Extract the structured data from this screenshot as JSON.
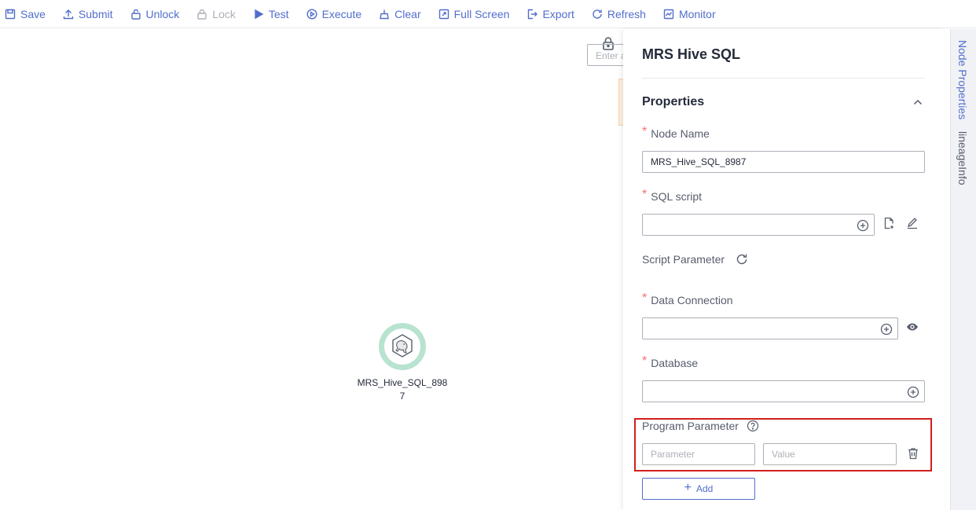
{
  "toolbar": {
    "save": "Save",
    "submit": "Submit",
    "unlock": "Unlock",
    "lock": "Lock",
    "test": "Test",
    "execute": "Execute",
    "clear": "Clear",
    "full_screen": "Full Screen",
    "export": "Export",
    "refresh": "Refresh",
    "monitor": "Monitor"
  },
  "canvas": {
    "search_placeholder": "Enter a",
    "node_label": "MRS_Hive_SQL_8987"
  },
  "panel": {
    "title": "MRS Hive SQL",
    "section": "Properties",
    "node_name_label": "Node Name",
    "node_name_value": "MRS_Hive_SQL_8987",
    "sql_script_label": "SQL script",
    "script_parameter_label": "Script Parameter",
    "data_connection_label": "Data Connection",
    "database_label": "Database",
    "program_parameter_label": "Program Parameter",
    "parameter_placeholder": "Parameter",
    "value_placeholder": "Value",
    "add_label": "Add"
  },
  "side_tabs": {
    "node_properties": "Node Properties",
    "lineage_info": "lineageInfo"
  },
  "colors": {
    "accent": "#526ecc",
    "required": "#f66f6a",
    "highlight_border": "#d21e1e",
    "node_ring": "#b8e3d0"
  }
}
